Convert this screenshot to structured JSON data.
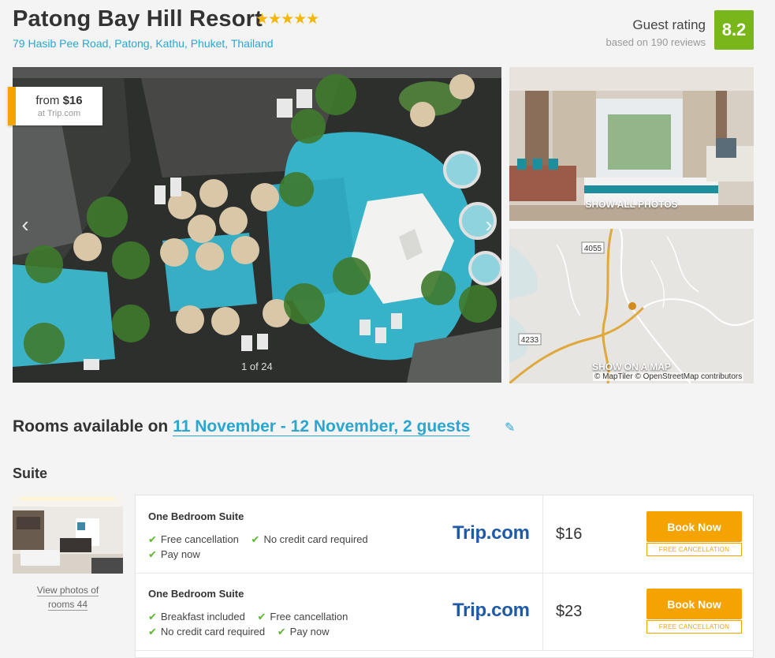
{
  "hotel": {
    "name": "Patong Bay Hill Resort",
    "stars": "★★★★★",
    "address": "79 Hasib Pee Road, Patong, Kathu, Phuket, Thailand"
  },
  "rating": {
    "label": "Guest rating",
    "reviews": "based on 190 reviews",
    "score": "8.2",
    "color": "#78b619"
  },
  "gallery": {
    "from_prefix": "from",
    "from_price": "$16",
    "from_source": "at Trip.com",
    "counter": "1 of 24",
    "prev_icon": "chevron-left-icon",
    "next_icon": "chevron-right-icon",
    "show_all": "SHOW ALL PHOTOS",
    "show_map": "SHOW ON A MAP",
    "map_credit": "© MapTiler © OpenStreetMap contributors",
    "road_labels": [
      "4055",
      "4233"
    ]
  },
  "availability": {
    "prefix": "Rooms available on",
    "dates": "11 November - 12 November, 2 guests",
    "edit_icon": "pencil-icon"
  },
  "room_type": {
    "name": "Suite",
    "view_photos_line1": "View photos of",
    "view_photos_line2": "rooms 44"
  },
  "offers": [
    {
      "room": "One Bedroom Suite",
      "features_line1": [
        "Free cancellation",
        "No credit card required"
      ],
      "features_line2": [
        "Pay now"
      ],
      "provider": "Trip.com",
      "price": "$16",
      "book_label": "Book Now",
      "book_sub": "FREE CANCELLATION"
    },
    {
      "room": "One Bedroom Suite",
      "features_line1": [
        "Breakfast included",
        "Free cancellation"
      ],
      "features_line2": [
        "No credit card required",
        "Pay now"
      ],
      "provider": "Trip.com",
      "price": "$23",
      "book_label": "Book Now",
      "book_sub": "FREE CANCELLATION"
    }
  ],
  "colors": {
    "accent": "#2aa6cf",
    "cta": "#f5a300",
    "check": "#5cb82e",
    "provider": "#1f5aa6"
  }
}
